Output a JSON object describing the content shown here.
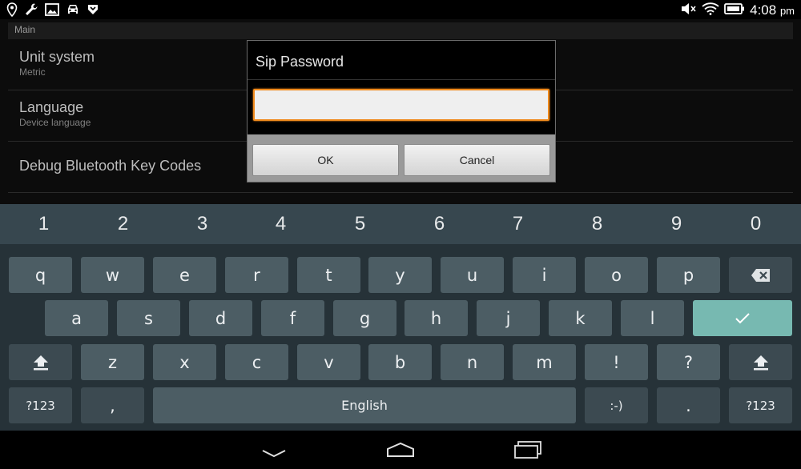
{
  "status_bar": {
    "left_icons": [
      "location-pin-icon",
      "wrench-icon",
      "image-icon",
      "car-icon",
      "download-icon"
    ],
    "right_icons": [
      "volume-muted-icon",
      "wifi-icon",
      "battery-icon"
    ],
    "time": "4:08",
    "ampm": "pm"
  },
  "settings": {
    "section_header": "Main",
    "items": [
      {
        "title": "Unit system",
        "summary": "Metric"
      },
      {
        "title": "Language",
        "summary": "Device language"
      },
      {
        "title": "Debug Bluetooth Key Codes",
        "summary": ""
      }
    ]
  },
  "dialog": {
    "title": "Sip Password",
    "input_value": "",
    "ok_label": "OK",
    "cancel_label": "Cancel",
    "focus_color": "#f08a1c"
  },
  "keyboard": {
    "number_row": [
      "1",
      "2",
      "3",
      "4",
      "5",
      "6",
      "7",
      "8",
      "9",
      "0"
    ],
    "row1": [
      "q",
      "w",
      "e",
      "r",
      "t",
      "y",
      "u",
      "i",
      "o",
      "p"
    ],
    "row2": [
      "a",
      "s",
      "d",
      "f",
      "g",
      "h",
      "j",
      "k",
      "l"
    ],
    "row3": [
      "z",
      "x",
      "c",
      "v",
      "b",
      "n",
      "m",
      "!",
      "?"
    ],
    "symbols_label": "?123",
    "comma_label": ",",
    "space_label": "English",
    "smiley_label": ":-)",
    "period_label": ".",
    "symbols_label_right": "?123",
    "accent_color": "#77b9b1",
    "icons": {
      "backspace": "backspace-icon",
      "enter": "checkmark-icon",
      "shift": "shift-icon"
    }
  },
  "navigation_bar": {
    "icons": [
      "back-chevron-icon",
      "home-icon",
      "recents-icon"
    ]
  }
}
